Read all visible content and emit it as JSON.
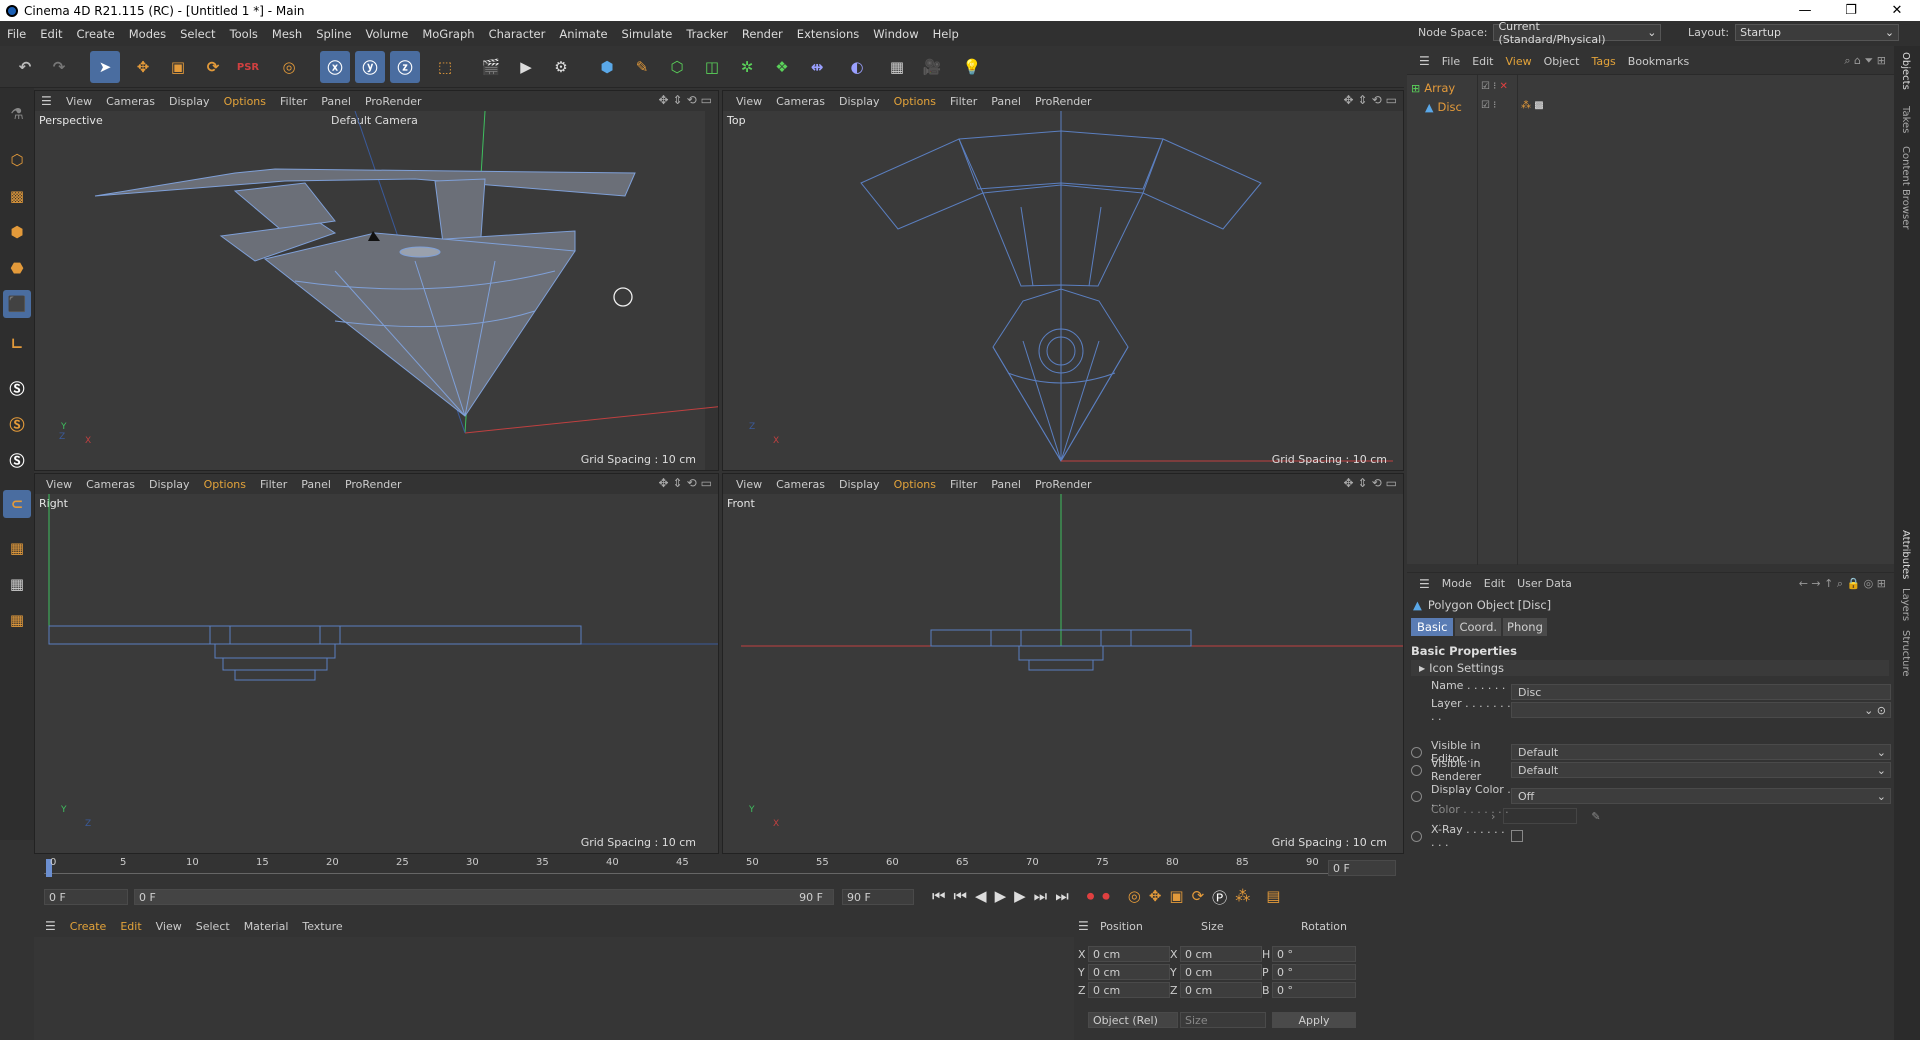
{
  "titlebar": {
    "title": "Cinema 4D R21.115 (RC) - [Untitled 1 *] - Main",
    "min": "—",
    "max": "❐",
    "close": "✕"
  },
  "menu": [
    "File",
    "Edit",
    "Create",
    "Modes",
    "Select",
    "Tools",
    "Mesh",
    "Spline",
    "Volume",
    "MoGraph",
    "Character",
    "Animate",
    "Simulate",
    "Tracker",
    "Render",
    "Extensions",
    "Window",
    "Help"
  ],
  "nodespace": {
    "label": "Node Space:",
    "value": "Current (Standard/Physical)"
  },
  "layout": {
    "label": "Layout:",
    "value": "Startup"
  },
  "toolbar_icons": [
    "undo-icon",
    "redo-icon",
    "select-icon",
    "move-icon",
    "scale-icon",
    "rotate-icon",
    "psr-icon",
    "recent-icon",
    "x-axis-icon",
    "y-axis-icon",
    "z-axis-icon",
    "coord-system-icon",
    "render-view-icon",
    "render-picture-viewer-icon",
    "render-settings-icon",
    "cube-icon",
    "pen-icon",
    "subdivision-icon",
    "extrude-icon",
    "cloner-icon",
    "effector-icon",
    "deformer-icon",
    "field-icon",
    "floor-icon",
    "camera-icon",
    "light-icon"
  ],
  "viewport_menu": [
    "View",
    "Cameras",
    "Display",
    "Options",
    "Filter",
    "Panel",
    "ProRender"
  ],
  "viewports": [
    {
      "label": "Perspective",
      "camera": "Default Camera",
      "grid": "Grid Spacing : 10 cm"
    },
    {
      "label": "Top",
      "grid": "Grid Spacing : 10 cm"
    },
    {
      "label": "Right",
      "grid": "Grid Spacing : 10 cm"
    },
    {
      "label": "Front",
      "grid": "Grid Spacing : 10 cm"
    }
  ],
  "objects_panel": {
    "menu": [
      "File",
      "Edit",
      "View",
      "Object",
      "Tags",
      "Bookmarks"
    ],
    "items": [
      {
        "name": "Array",
        "color": "#e39a3a"
      },
      {
        "name": "Disc",
        "color": "#e39a3a"
      }
    ]
  },
  "side_tabs": [
    "Objects",
    "Takes",
    "Content Browser",
    "Attributes",
    "Layers",
    "Structure"
  ],
  "attributes": {
    "menu": [
      "Mode",
      "Edit",
      "User Data"
    ],
    "object_title": "Polygon Object [Disc]",
    "tabs": [
      "Basic",
      "Coord.",
      "Phong"
    ],
    "section": "Basic Properties",
    "icon_settings": "Icon Settings",
    "rows": [
      {
        "label": "Name . . . . . . . . .",
        "value": "Disc"
      },
      {
        "label": "Layer . . . . . . . . .",
        "value": ""
      },
      {
        "label": "Visible in Editor . .",
        "value": "Default"
      },
      {
        "label": "Visible in Renderer",
        "value": "Default"
      },
      {
        "label": "Display Color . . .",
        "value": "Off"
      },
      {
        "label": "Color . . . . . . . . .",
        "value": ""
      },
      {
        "label": "X-Ray . . . . . . . . .",
        "value": ""
      }
    ]
  },
  "timeline": {
    "ticks": [
      "0",
      "5",
      "10",
      "15",
      "20",
      "25",
      "30",
      "35",
      "40",
      "45",
      "50",
      "55",
      "60",
      "65",
      "70",
      "75",
      "80",
      "85",
      "90"
    ],
    "current": "0 F",
    "start": "0 F",
    "range_start": "0 F",
    "range_end": "90 F",
    "end": "90 F"
  },
  "material_menu": [
    "Create",
    "Edit",
    "View",
    "Select",
    "Material",
    "Texture"
  ],
  "coords": {
    "headers": [
      "Position",
      "Size",
      "Rotation"
    ],
    "rows": [
      {
        "pl": "X",
        "pv": "0 cm",
        "sl": "X",
        "sv": "0 cm",
        "rl": "H",
        "rv": "0 °"
      },
      {
        "pl": "Y",
        "pv": "0 cm",
        "sl": "Y",
        "sv": "0 cm",
        "rl": "P",
        "rv": "0 °"
      },
      {
        "pl": "Z",
        "pv": "0 cm",
        "sl": "Z",
        "sv": "0 cm",
        "rl": "B",
        "rv": "0 °"
      }
    ],
    "mode": "Object (Rel)",
    "size_mode": "Size",
    "apply": "Apply"
  }
}
